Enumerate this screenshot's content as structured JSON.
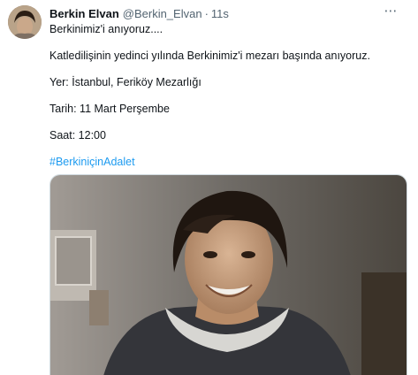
{
  "tweet": {
    "author_name": "Berkin Elvan",
    "author_handle": "@Berkin_Elvan",
    "separator": "·",
    "time": "11s",
    "more_icon": "more-horizontal-icon",
    "lines": [
      "Berkinimiz'i anıyoruz....",
      "Katledilişinin yedinci yılında Berkinimiz'i mezarı başında anıyoruz.",
      "Yer: İstanbul, Feriköy Mezarlığı",
      "Tarih: 11 Mart Perşembe",
      "Saat: 12:00"
    ],
    "hashtag": "#BerkiniçinAdalet"
  },
  "colors": {
    "text": "#0f1419",
    "secondary": "#536471",
    "link": "#1d9bf0",
    "background": "#ffffff"
  }
}
